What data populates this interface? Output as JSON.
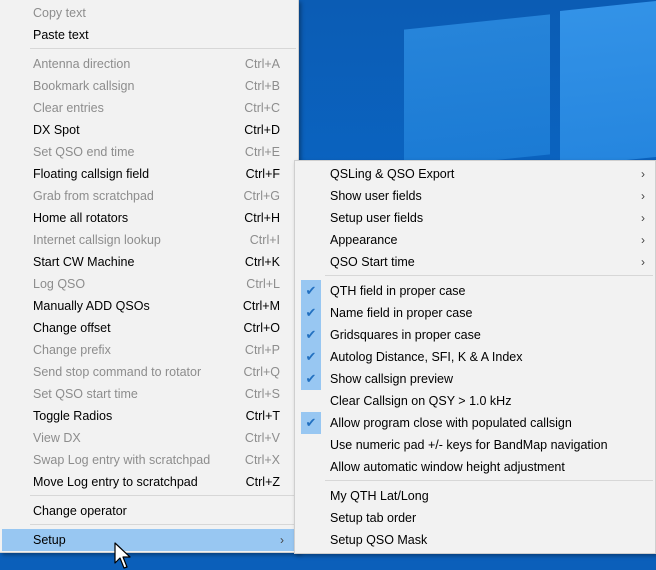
{
  "main_menu": {
    "items": [
      {
        "label": "Copy text",
        "shortcut": "",
        "enabled": false
      },
      {
        "label": "Paste text",
        "shortcut": "",
        "enabled": true
      },
      {
        "label": "Antenna direction",
        "shortcut": "Ctrl+A",
        "enabled": false
      },
      {
        "label": "Bookmark callsign",
        "shortcut": "Ctrl+B",
        "enabled": false
      },
      {
        "label": "Clear entries",
        "shortcut": "Ctrl+C",
        "enabled": false
      },
      {
        "label": "DX Spot",
        "shortcut": "Ctrl+D",
        "enabled": true
      },
      {
        "label": "Set QSO end time",
        "shortcut": "Ctrl+E",
        "enabled": false
      },
      {
        "label": "Floating callsign field",
        "shortcut": "Ctrl+F",
        "enabled": true
      },
      {
        "label": "Grab from scratchpad",
        "shortcut": "Ctrl+G",
        "enabled": false
      },
      {
        "label": "Home all rotators",
        "shortcut": "Ctrl+H",
        "enabled": true
      },
      {
        "label": "Internet callsign lookup",
        "shortcut": "Ctrl+I",
        "enabled": false
      },
      {
        "label": "Start CW Machine",
        "shortcut": "Ctrl+K",
        "enabled": true
      },
      {
        "label": "Log QSO",
        "shortcut": "Ctrl+L",
        "enabled": false
      },
      {
        "label": "Manually ADD QSOs",
        "shortcut": "Ctrl+M",
        "enabled": true
      },
      {
        "label": "Change offset",
        "shortcut": "Ctrl+O",
        "enabled": true
      },
      {
        "label": "Change prefix",
        "shortcut": "Ctrl+P",
        "enabled": false
      },
      {
        "label": "Send stop command to rotator",
        "shortcut": "Ctrl+Q",
        "enabled": false
      },
      {
        "label": "Set QSO start time",
        "shortcut": "Ctrl+S",
        "enabled": false
      },
      {
        "label": "Toggle Radios",
        "shortcut": "Ctrl+T",
        "enabled": true
      },
      {
        "label": "View DX",
        "shortcut": "Ctrl+V",
        "enabled": false
      },
      {
        "label": "Swap Log entry with scratchpad",
        "shortcut": "Ctrl+X",
        "enabled": false
      },
      {
        "label": "Move Log entry to scratchpad",
        "shortcut": "Ctrl+Z",
        "enabled": true
      },
      {
        "label": "Change operator",
        "shortcut": "",
        "enabled": true
      },
      {
        "label": "Setup",
        "shortcut": "",
        "enabled": true,
        "submenu": true,
        "highlighted": true
      }
    ],
    "arrow": "›"
  },
  "setup_submenu": {
    "items": [
      {
        "label": "QSLing & QSO Export",
        "submenu": true,
        "checked": false
      },
      {
        "label": "Show user fields",
        "submenu": true,
        "checked": false
      },
      {
        "label": "Setup user fields",
        "submenu": true,
        "checked": false
      },
      {
        "label": "Appearance",
        "submenu": true,
        "checked": false
      },
      {
        "label": "QSO Start time",
        "submenu": true,
        "checked": false
      },
      {
        "label": "QTH field in proper case",
        "submenu": false,
        "checked": true
      },
      {
        "label": "Name field in proper case",
        "submenu": false,
        "checked": true
      },
      {
        "label": "Gridsquares in proper case",
        "submenu": false,
        "checked": true
      },
      {
        "label": "Autolog Distance, SFI, K & A Index",
        "submenu": false,
        "checked": true
      },
      {
        "label": "Show callsign preview",
        "submenu": false,
        "checked": true
      },
      {
        "label": "Clear Callsign on QSY > 1.0 kHz",
        "submenu": false,
        "checked": false
      },
      {
        "label": "Allow program close with populated callsign",
        "submenu": false,
        "checked": true
      },
      {
        "label": "Use numeric pad +/- keys for BandMap navigation",
        "submenu": false,
        "checked": false
      },
      {
        "label": "Allow automatic window height adjustment",
        "submenu": false,
        "checked": false
      },
      {
        "label": "My QTH Lat/Long",
        "submenu": false,
        "checked": false
      },
      {
        "label": "Setup tab order",
        "submenu": false,
        "checked": false
      },
      {
        "label": "Setup QSO Mask",
        "submenu": false,
        "checked": false
      }
    ],
    "check_glyph": "✔",
    "arrow": "›"
  },
  "colors": {
    "highlight": "#98c7f2",
    "menu_bg": "#f2f2f2",
    "disabled_text": "#8d8d8d",
    "desktop": "#0d63b9"
  }
}
